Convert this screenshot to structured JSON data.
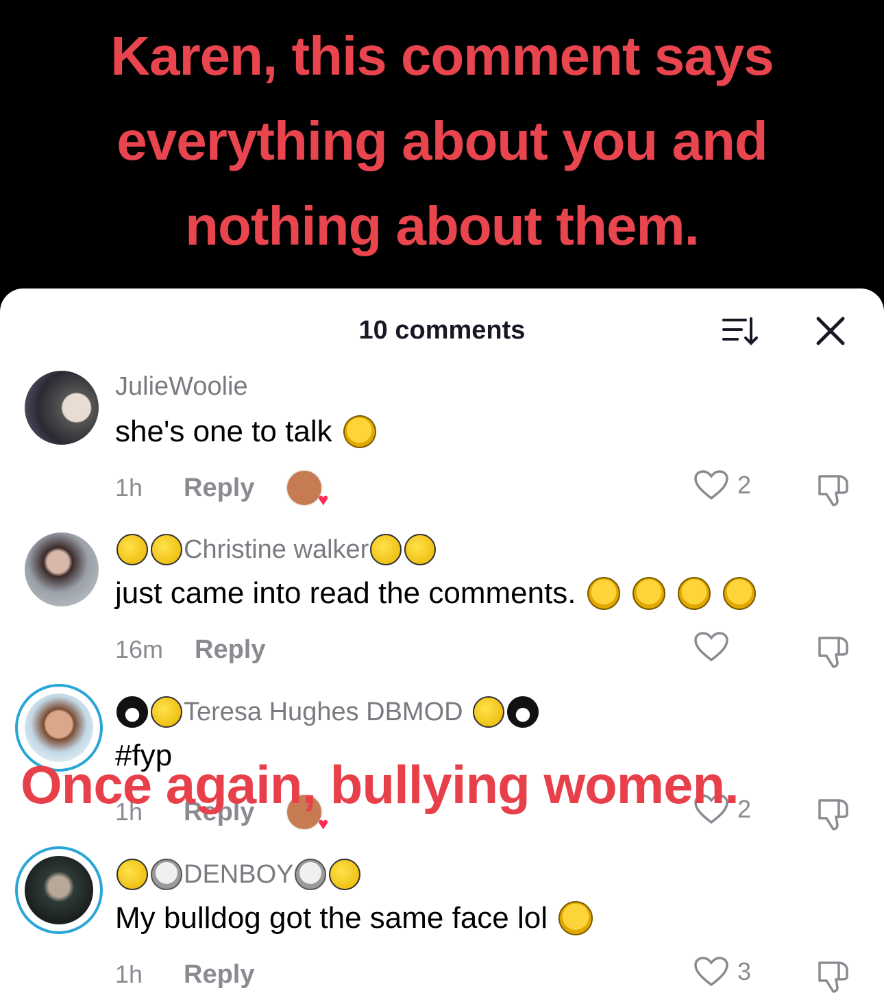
{
  "video": {
    "caption_lines": [
      "Karen, this comment says",
      "everything about you and",
      "nothing about them."
    ]
  },
  "sheet": {
    "title": "10 comments",
    "sort_icon": "sort-icon",
    "close_icon": "close-icon"
  },
  "comments": [
    {
      "username": "JulieWoolie",
      "text": "she's one to talk",
      "time": "1h",
      "reply_label": "Reply",
      "likes": "2",
      "creator_liked": true
    },
    {
      "username": "Christine walker",
      "text": "just came into read the comments.",
      "time": "16m",
      "reply_label": "Reply",
      "likes": "",
      "creator_liked": false
    },
    {
      "username": "Teresa Hughes DBMOD",
      "text": "#fyp",
      "time": "1h",
      "reply_label": "Reply",
      "likes": "2",
      "creator_liked": true
    },
    {
      "username": "DENBOY",
      "text": "My bulldog got the same face lol",
      "time": "1h",
      "reply_label": "Reply",
      "likes": "3",
      "creator_liked": false
    }
  ],
  "overlay": {
    "text": "Once again, bullying women."
  },
  "colors": {
    "caption_red": "#e8454f",
    "like_heart": "#fe2c55",
    "ring_blue": "#2aa6d6"
  }
}
